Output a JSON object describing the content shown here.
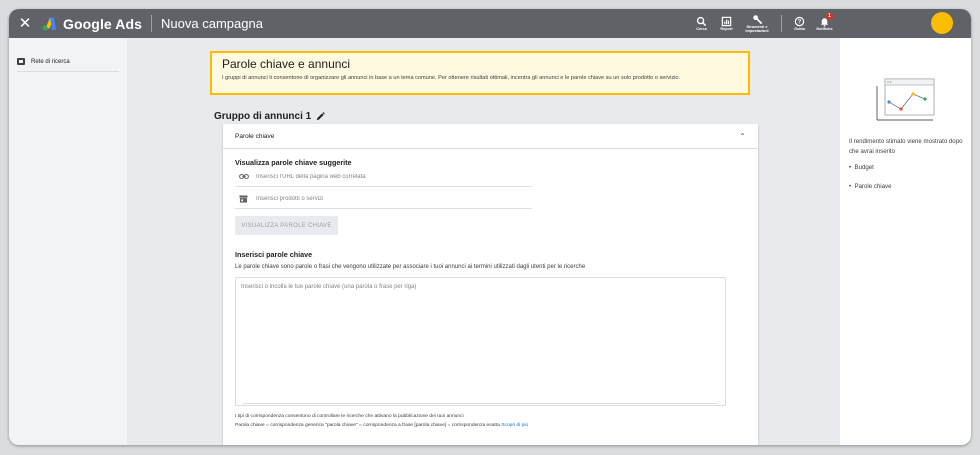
{
  "topbar": {
    "brand": "Google Ads",
    "campaign": "Nuova campagna",
    "tools": [
      {
        "icon": "search-icon",
        "label": "Cerca"
      },
      {
        "icon": "report-icon",
        "label": "Report"
      },
      {
        "icon": "wrench-icon",
        "label": "Strumenti e impostazioni"
      },
      {
        "icon": "help-icon",
        "label": "Guida"
      },
      {
        "icon": "bell-icon",
        "label": "Notifiche",
        "badge": "1"
      }
    ],
    "avatar_color": "#fbbc04"
  },
  "sidebar": {
    "items": [
      {
        "icon": "search-network-icon",
        "label": "Rete di ricerca"
      }
    ]
  },
  "intro": {
    "title": "Parole chiave e annunci",
    "description": "I gruppi di annunci ti consentono di organizzare gli annunci in base a un tema comune. Per ottenere risultati ottimali, incentra gli annunci e le parole chiave su un solo prodotto o servizio."
  },
  "adgroup": {
    "title": "Gruppo di annunci 1"
  },
  "keywords_card": {
    "header": "Parole chiave",
    "suggest_title": "Visualizza parole chiave suggerite",
    "url_placeholder": "Inserisci l'URL della pagina web correlata",
    "product_placeholder": "Inserisci prodotti o servizi",
    "show_button": "VISUALIZZA PAROLE CHIAVE",
    "enter_title": "Inserisci parole chiave",
    "enter_desc": "Le parole chiave sono parole o frasi che vengono utilizzate per associare i tuoi annunci ai termini utilizzati dagli utenti per le ricerche",
    "textarea_placeholder": "Inserisci o incolla le tue parole chiave (una parola o frase per riga)",
    "match_info": "I tipi di corrispondenza consentono di controllare le ricerche che attivano la pubblicazione dei tuoi annunci",
    "match_examples": "Parola chiave = corrispondenza generica  \"parola chiave\" = corrispondenza a frase  [parola chiave] = corrispondenza esatta",
    "learn_more": "Scopri di più"
  },
  "right_panel": {
    "text": "Il rendimento stimato viene mostrato dopo che avrai inserito",
    "bullets": [
      "Budget",
      "Parole chiave"
    ]
  },
  "colors": {
    "topbar": "#5f6368",
    "highlight_border": "#fbbc04",
    "link": "#1a73e8"
  }
}
